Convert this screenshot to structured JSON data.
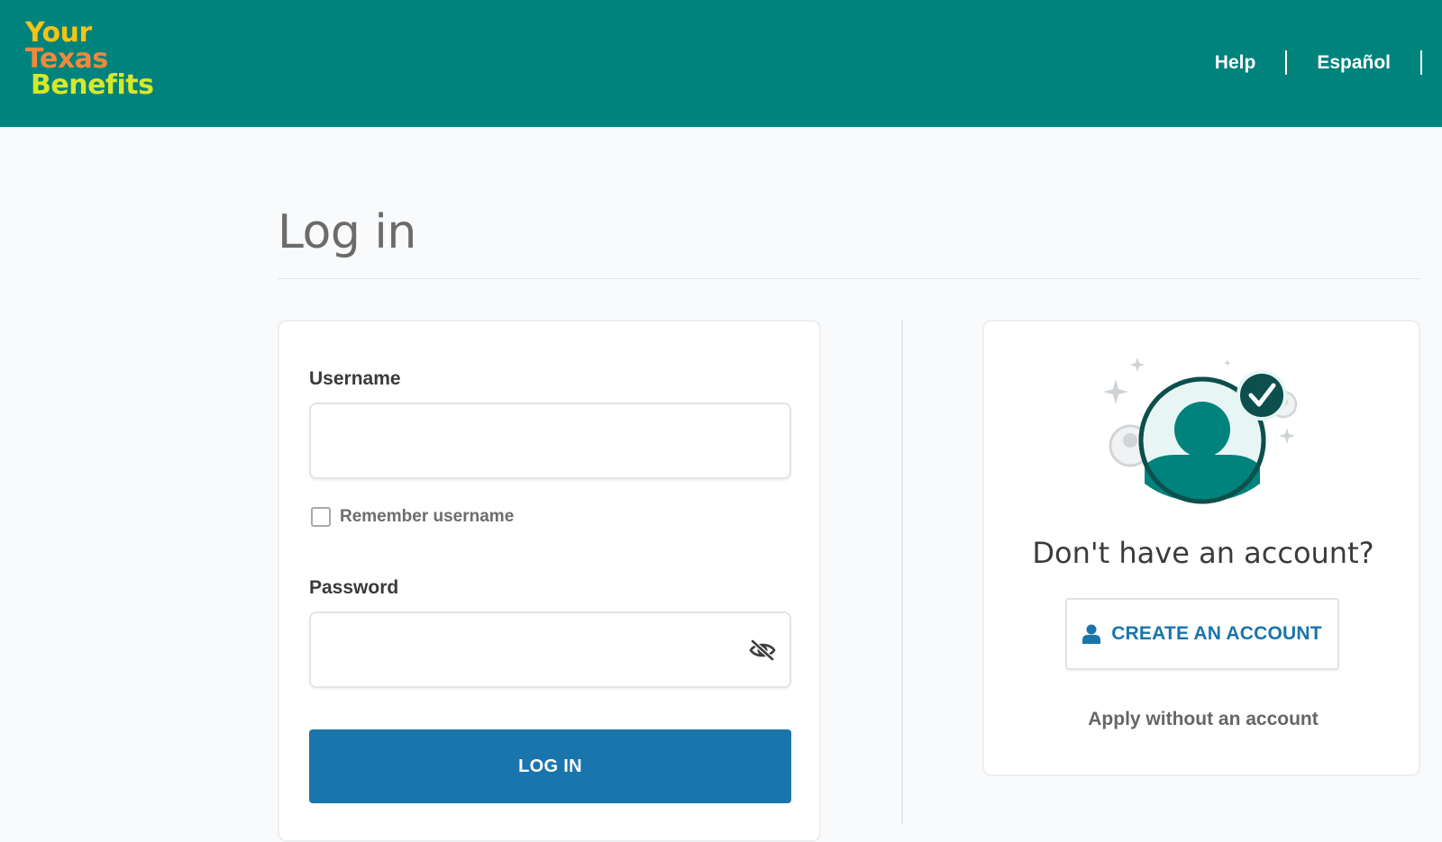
{
  "header": {
    "logo": {
      "line1": "Your",
      "line2": "Texas",
      "line3": "Benefits"
    },
    "nav": {
      "help": "Help",
      "spanish": "Español"
    },
    "colors": {
      "background": "#00827d",
      "logo_your": "#f6c312",
      "logo_texas": "#f1893b",
      "logo_benefits": "#d6e82a"
    }
  },
  "page": {
    "title": "Log in"
  },
  "login_form": {
    "username_label": "Username",
    "username_value": "",
    "remember_label": "Remember username",
    "remember_checked": false,
    "password_label": "Password",
    "password_value": "",
    "password_toggle_icon": "eye-slash-icon",
    "submit_label": "LOG IN",
    "submit_color": "#1a75ac"
  },
  "signup": {
    "illustration_icon": "verified-user-icon",
    "heading": "Don't have an account?",
    "create_icon": "user-icon",
    "create_label": "CREATE AN ACCOUNT",
    "apply_label": "Apply without an account"
  }
}
